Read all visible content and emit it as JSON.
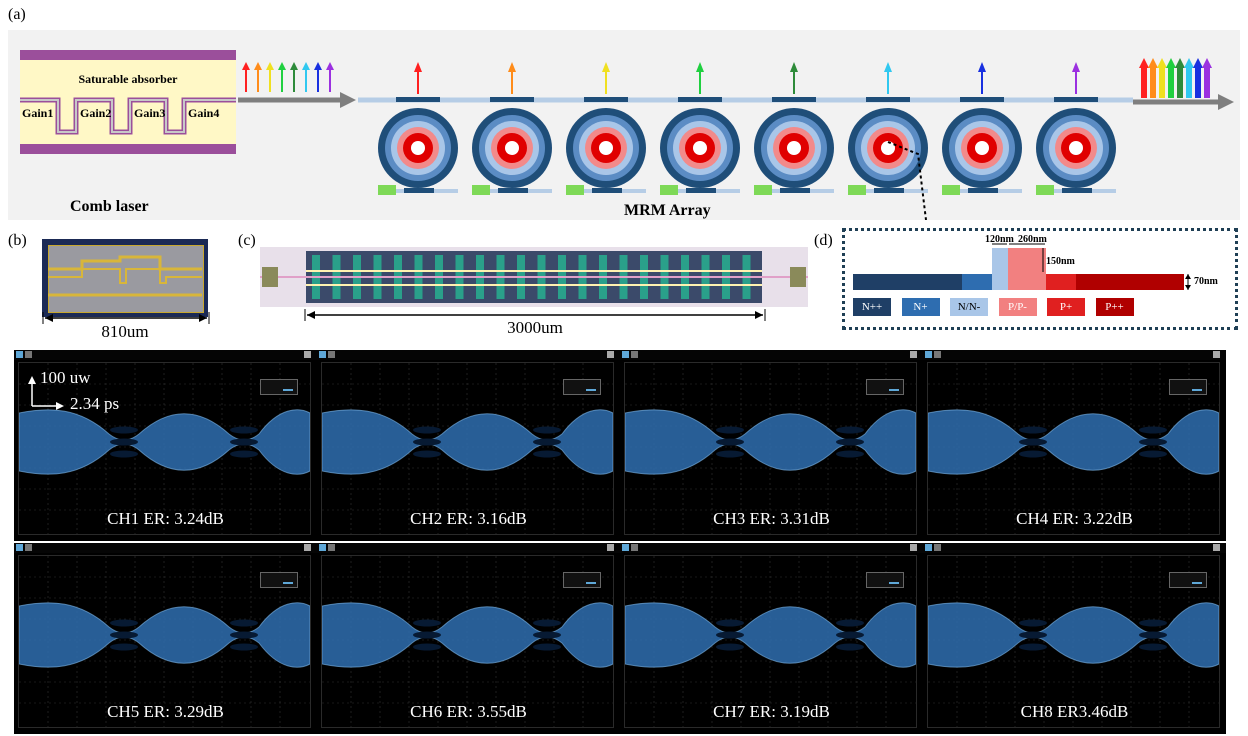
{
  "panel_labels": {
    "a": "(a)",
    "b": "(b)",
    "c": "(c)",
    "d": "(d)"
  },
  "comb": {
    "saturable_absorber": "Saturable absorber",
    "gains": [
      "Gain1",
      "Gain2",
      "Gain3",
      "Gain4"
    ],
    "caption": "Comb laser"
  },
  "mrm_caption": "MRM Array",
  "colors": {
    "comb_lines": [
      "#ff2020",
      "#ff8c1a",
      "#f0e020",
      "#20d040",
      "#2e8b3a",
      "#30c8f0",
      "#1830e0",
      "#9b30e0"
    ],
    "ring_outer": "#1f4e79",
    "ring_mid": "#5b8cc4",
    "ring_light": "#a9c6e8",
    "ring_pink": "#f28a8a",
    "ring_red": "#e00000",
    "heater": "#7ed957",
    "waveguide": "#b6cde6",
    "arrow": "#7f7f7f"
  },
  "photo_b_label": "810um",
  "photo_c_label": "3000um",
  "doping": {
    "dims": [
      "120nm",
      "260nm",
      "150nm",
      "70nm"
    ],
    "legend": [
      {
        "label": "N++",
        "color": "#1f3f66"
      },
      {
        "label": "N+",
        "color": "#2e6db0"
      },
      {
        "label": "N/N-",
        "color": "#a9c6e8"
      },
      {
        "label": "P/P-",
        "color": "#f28080"
      },
      {
        "label": "P+",
        "color": "#e02020"
      },
      {
        "label": "P++",
        "color": "#b00000"
      }
    ]
  },
  "scale": {
    "power": "100 uw",
    "time": "2.34 ps"
  },
  "eyes": [
    {
      "label": "CH1 ER: 3.24dB"
    },
    {
      "label": "CH2 ER: 3.16dB"
    },
    {
      "label": "CH3 ER: 3.31dB"
    },
    {
      "label": "CH4 ER: 3.22dB"
    },
    {
      "label": "CH5 ER: 3.29dB"
    },
    {
      "label": "CH6 ER: 3.55dB"
    },
    {
      "label": "CH7  ER: 3.19dB"
    },
    {
      "label": "CH8 ER3.46dB"
    }
  ]
}
